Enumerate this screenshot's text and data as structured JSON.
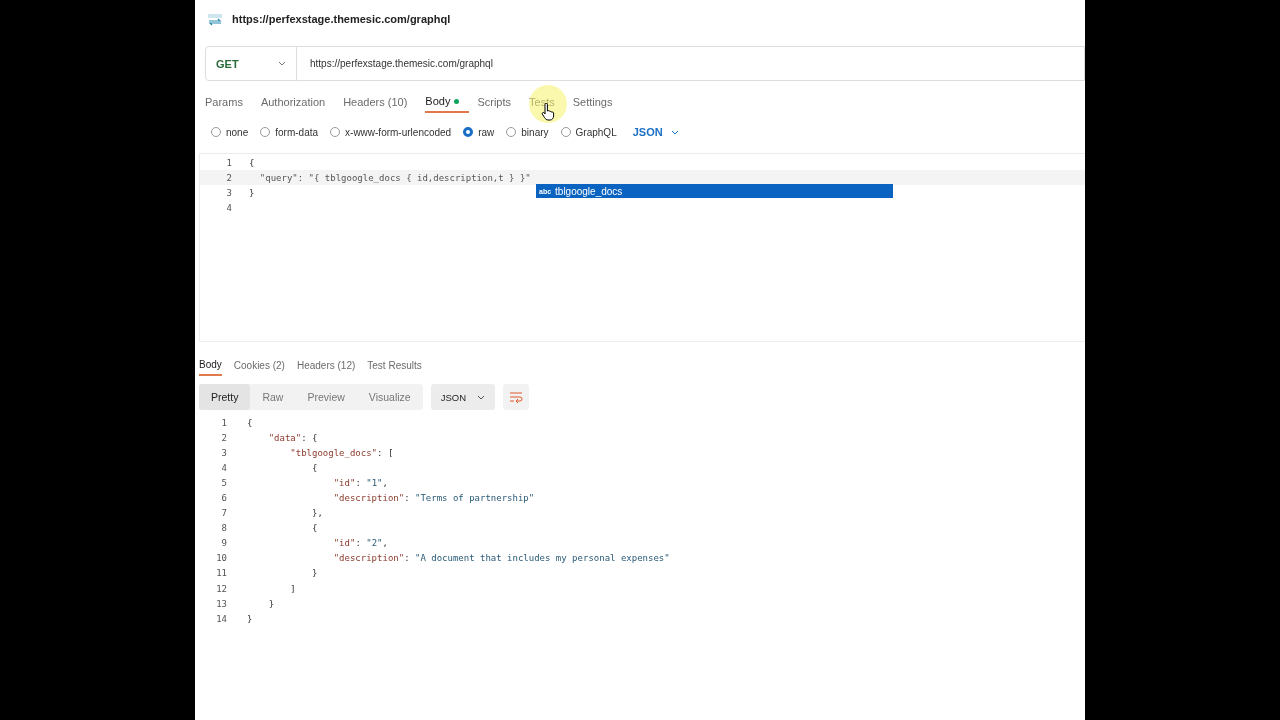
{
  "request_title": "https://perfexstage.themesic.com/graphql",
  "request": {
    "method": "GET",
    "url": "https://perfexstage.themesic.com/graphql"
  },
  "request_tabs": [
    {
      "label": "Params",
      "selected": false,
      "dot": false
    },
    {
      "label": "Authorization",
      "selected": false,
      "dot": false
    },
    {
      "label": "Headers (10)",
      "selected": false,
      "dot": false
    },
    {
      "label": "Body",
      "selected": true,
      "dot": true
    },
    {
      "label": "Scripts",
      "selected": false,
      "dot": false
    },
    {
      "label": "Tests",
      "selected": false,
      "dot": false
    },
    {
      "label": "Settings",
      "selected": false,
      "dot": false
    }
  ],
  "body_types": [
    {
      "label": "none",
      "selected": false
    },
    {
      "label": "form-data",
      "selected": false
    },
    {
      "label": "x-www-form-urlencoded",
      "selected": false
    },
    {
      "label": "raw",
      "selected": true
    },
    {
      "label": "binary",
      "selected": false
    },
    {
      "label": "GraphQL",
      "selected": false
    }
  ],
  "body_format": "JSON",
  "editor": {
    "lines": [
      {
        "number": "1",
        "tokens": [
          {
            "kind": "punct",
            "text": "{"
          }
        ]
      },
      {
        "number": "2",
        "tokens": [
          {
            "kind": "plain",
            "text": "  \"query\": \"{ tblgoogle_docs { id,description,t } }\""
          }
        ]
      },
      {
        "number": "3",
        "tokens": [
          {
            "kind": "punct",
            "text": "}"
          }
        ]
      },
      {
        "number": "4"
      }
    ],
    "suggestion": {
      "badge": "abc",
      "text": "tblgoogle_docs"
    }
  },
  "response_tabs": [
    {
      "label": "Body",
      "selected": true
    },
    {
      "label": "Cookies (2)",
      "selected": false
    },
    {
      "label": "Headers (12)",
      "selected": false
    },
    {
      "label": "Test Results",
      "selected": false
    }
  ],
  "view_modes": [
    {
      "label": "Pretty",
      "selected": true
    },
    {
      "label": "Raw",
      "selected": false
    },
    {
      "label": "Preview",
      "selected": false
    },
    {
      "label": "Visualize",
      "selected": false
    }
  ],
  "response_format": "JSON",
  "response": {
    "lines": [
      {
        "number": "1",
        "tokens": [
          {
            "kind": "punct",
            "text": "{"
          }
        ]
      },
      {
        "number": "2",
        "tokens": [
          {
            "kind": "key",
            "text": "    \"data\""
          },
          {
            "kind": "punct",
            "text": ": {"
          }
        ]
      },
      {
        "number": "3",
        "tokens": [
          {
            "kind": "key",
            "text": "        \"tblgoogle_docs\""
          },
          {
            "kind": "punct",
            "text": ": ["
          }
        ]
      },
      {
        "number": "4",
        "tokens": [
          {
            "kind": "punct",
            "text": "            {"
          }
        ]
      },
      {
        "number": "5",
        "tokens": [
          {
            "kind": "key",
            "text": "                \"id\""
          },
          {
            "kind": "punct",
            "text": ": "
          },
          {
            "kind": "string",
            "text": "\"1\""
          },
          {
            "kind": "punct",
            "text": ","
          }
        ]
      },
      {
        "number": "6",
        "tokens": [
          {
            "kind": "key",
            "text": "                \"description\""
          },
          {
            "kind": "punct",
            "text": ": "
          },
          {
            "kind": "string",
            "text": "\"Terms of partnership\""
          }
        ]
      },
      {
        "number": "7",
        "tokens": [
          {
            "kind": "punct",
            "text": "            },"
          }
        ]
      },
      {
        "number": "8",
        "tokens": [
          {
            "kind": "punct",
            "text": "            {"
          }
        ]
      },
      {
        "number": "9",
        "tokens": [
          {
            "kind": "key",
            "text": "                \"id\""
          },
          {
            "kind": "punct",
            "text": ": "
          },
          {
            "kind": "string",
            "text": "\"2\""
          },
          {
            "kind": "punct",
            "text": ","
          }
        ]
      },
      {
        "number": "10",
        "tokens": [
          {
            "kind": "key",
            "text": "                \"description\""
          },
          {
            "kind": "punct",
            "text": ": "
          },
          {
            "kind": "string",
            "text": "\"A document that includes my personal expenses\""
          }
        ]
      },
      {
        "number": "11",
        "tokens": [
          {
            "kind": "punct",
            "text": "            }"
          }
        ]
      },
      {
        "number": "12",
        "tokens": [
          {
            "kind": "punct",
            "text": "        ]"
          }
        ]
      },
      {
        "number": "13",
        "tokens": [
          {
            "kind": "punct",
            "text": "    }"
          }
        ]
      },
      {
        "number": "14",
        "tokens": [
          {
            "kind": "punct",
            "text": "}"
          }
        ]
      }
    ]
  }
}
